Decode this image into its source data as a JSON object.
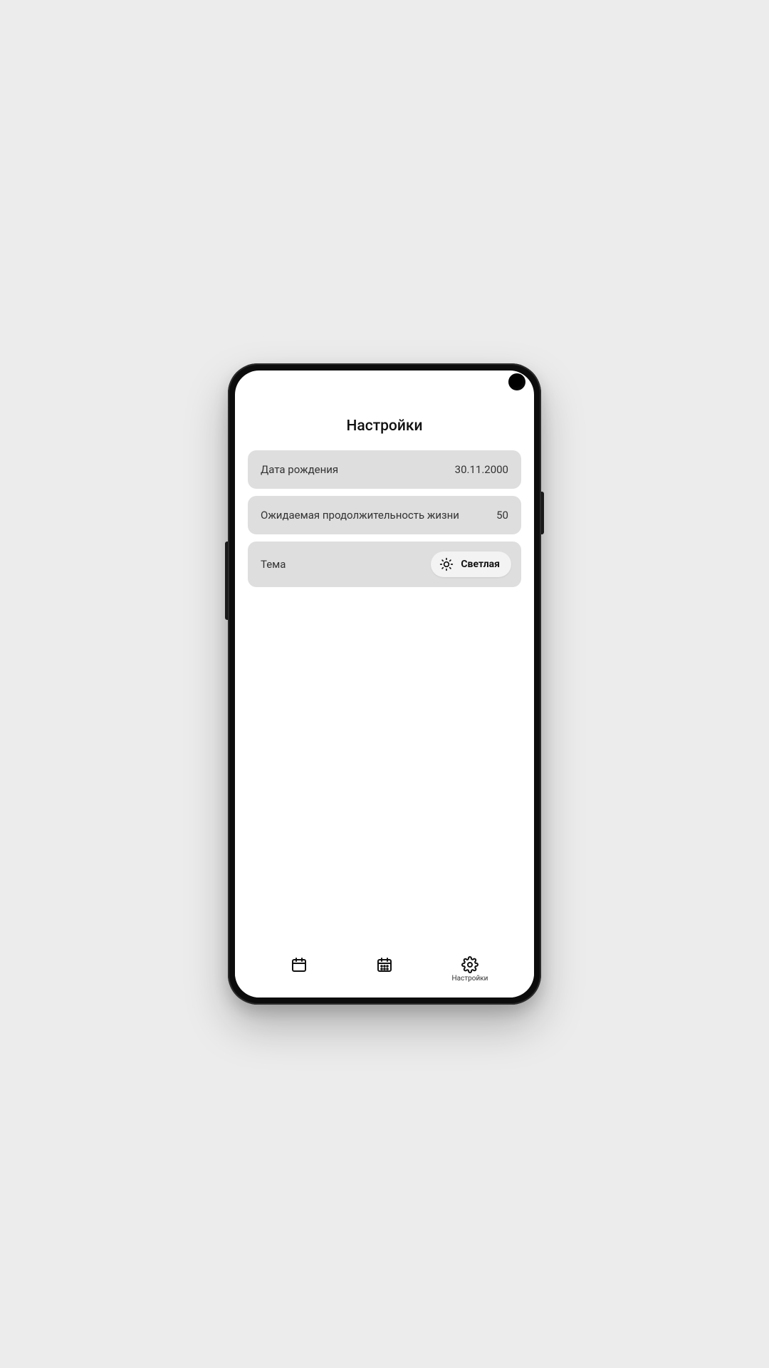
{
  "header": {
    "title": "Настройки"
  },
  "settings": {
    "birthdate": {
      "label": "Дата рождения",
      "value": "30.11.2000"
    },
    "lifespan": {
      "label": "Ожидаемая продолжительность жизни",
      "value": "50"
    },
    "theme": {
      "label": "Тема",
      "value": "Светлая",
      "icon": "sun-icon"
    }
  },
  "nav": {
    "items": [
      {
        "icon": "calendar-day-icon",
        "label": ""
      },
      {
        "icon": "calendar-month-icon",
        "label": ""
      },
      {
        "icon": "gear-icon",
        "label": "Настройки",
        "active": true
      }
    ]
  }
}
